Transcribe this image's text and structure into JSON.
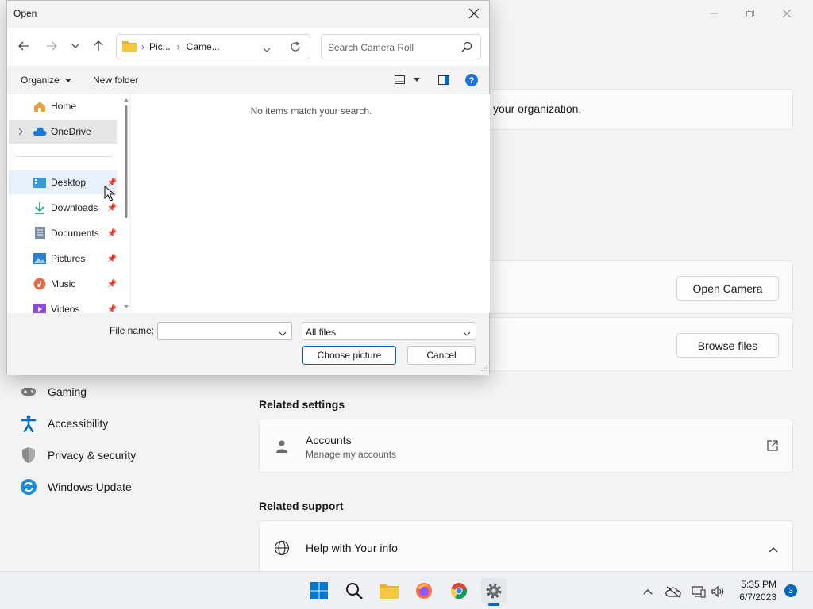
{
  "settings": {
    "org_text": "your organization.",
    "open_camera": "Open Camera",
    "browse_files": "Browse files",
    "nav": [
      {
        "label": "Gaming"
      },
      {
        "label": "Accessibility"
      },
      {
        "label": "Privacy & security"
      },
      {
        "label": "Windows Update"
      }
    ],
    "related_settings": "Related settings",
    "accounts_title": "Accounts",
    "accounts_sub": "Manage my accounts",
    "related_support": "Related support",
    "help_title": "Help with Your info"
  },
  "dialog": {
    "title": "Open",
    "breadcrumb": [
      "Pic...",
      "Came..."
    ],
    "search_placeholder": "Search Camera Roll",
    "organize": "Organize",
    "new_folder": "New folder",
    "tree": [
      {
        "label": "Home"
      },
      {
        "label": "OneDrive"
      },
      {
        "label": "Desktop"
      },
      {
        "label": "Downloads"
      },
      {
        "label": "Documents"
      },
      {
        "label": "Pictures"
      },
      {
        "label": "Music"
      },
      {
        "label": "Videos"
      }
    ],
    "empty_message": "No items match your search.",
    "file_name_label": "File name:",
    "file_name_value": "",
    "file_type": "All files",
    "choose_button": "Choose picture",
    "cancel_button": "Cancel"
  },
  "taskbar": {
    "time": "5:35 PM",
    "date": "6/7/2023",
    "notifications": "3"
  },
  "colors": {
    "accent": "#0067c0"
  }
}
